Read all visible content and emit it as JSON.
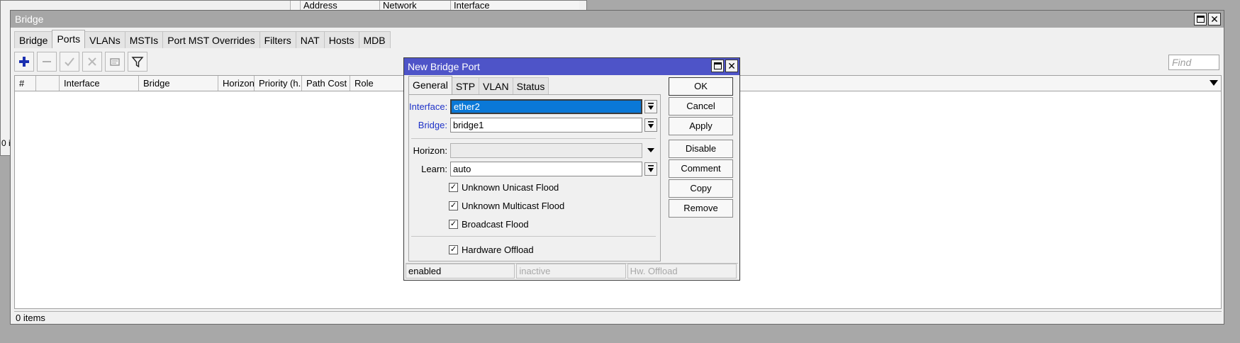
{
  "background_window": {
    "columns": [
      "Address",
      "Network",
      "Interface"
    ],
    "status": "0 i"
  },
  "window": {
    "title": "Bridge",
    "tabs": [
      "Bridge",
      "Ports",
      "VLANs",
      "MSTIs",
      "Port MST Overrides",
      "Filters",
      "NAT",
      "Hosts",
      "MDB"
    ],
    "active_tab": "Ports",
    "find_placeholder": "Find",
    "columns": [
      "#",
      "",
      "Interface",
      "Bridge",
      "Horizon",
      "Priority (h...",
      "Path Cost",
      "Role"
    ],
    "status": "0 items"
  },
  "dialog": {
    "title": "New Bridge Port",
    "tabs": [
      "General",
      "STP",
      "VLAN",
      "Status"
    ],
    "active_tab": "General",
    "fields": {
      "interface": {
        "label": "Interface:",
        "value": "ether2"
      },
      "bridge": {
        "label": "Bridge:",
        "value": "bridge1"
      },
      "horizon": {
        "label": "Horizon:",
        "value": ""
      },
      "learn": {
        "label": "Learn:",
        "value": "auto"
      }
    },
    "checkboxes": [
      {
        "label": "Unknown Unicast Flood",
        "checked": true
      },
      {
        "label": "Unknown Multicast Flood",
        "checked": true
      },
      {
        "label": "Broadcast Flood",
        "checked": true
      },
      {
        "label": "Hardware Offload",
        "checked": true
      }
    ],
    "buttons": [
      "OK",
      "Cancel",
      "Apply",
      "Disable",
      "Comment",
      "Copy",
      "Remove"
    ],
    "status": [
      "enabled",
      "inactive",
      "Hw. Offload"
    ]
  }
}
